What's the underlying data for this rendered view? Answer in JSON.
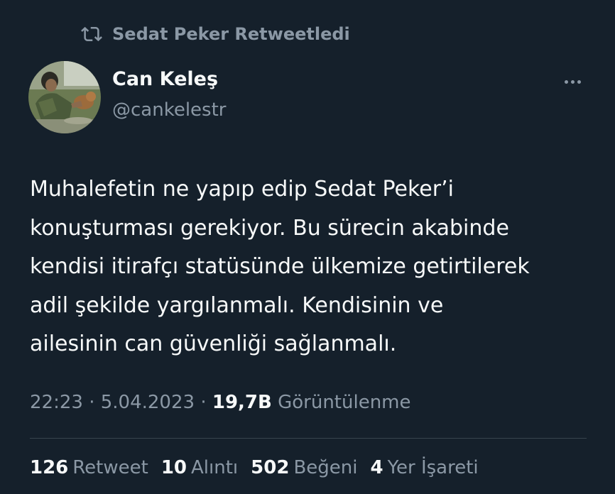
{
  "retweet_header": {
    "text": "Sedat Peker Retweetledi",
    "icon": "retweet-icon"
  },
  "author": {
    "name": "Can Keleş",
    "handle": "@cankelestr",
    "avatar": "avatar-photo"
  },
  "tweet": {
    "text": "Muhalefetin ne yapıp edip Sedat Peker’i\nkonuşturması gerekiyor. Bu sürecin akabinde\nkendisi itirafçı statüsünde ülkemize getirtilerek\nadil şekilde yargılanmalı. Kendisinin ve\nailesinin can güvenliği sağlanmalı."
  },
  "meta": {
    "time": "22:23",
    "separator1": "·",
    "date": "5.04.2023",
    "separator2": "·",
    "views_count": "19,7B",
    "views_label": "Görüntülenme"
  },
  "stats": {
    "retweets_count": "126",
    "retweets_label": "Retweet",
    "quotes_count": "10",
    "quotes_label": "Alıntı",
    "likes_count": "502",
    "likes_label": "Beğeni",
    "bookmarks_count": "4",
    "bookmarks_label": "Yer İşareti"
  },
  "colors": {
    "background": "#15202b",
    "primary_text": "#f7f9f9",
    "secondary_text": "#8b98a5",
    "divider": "#38444d"
  }
}
